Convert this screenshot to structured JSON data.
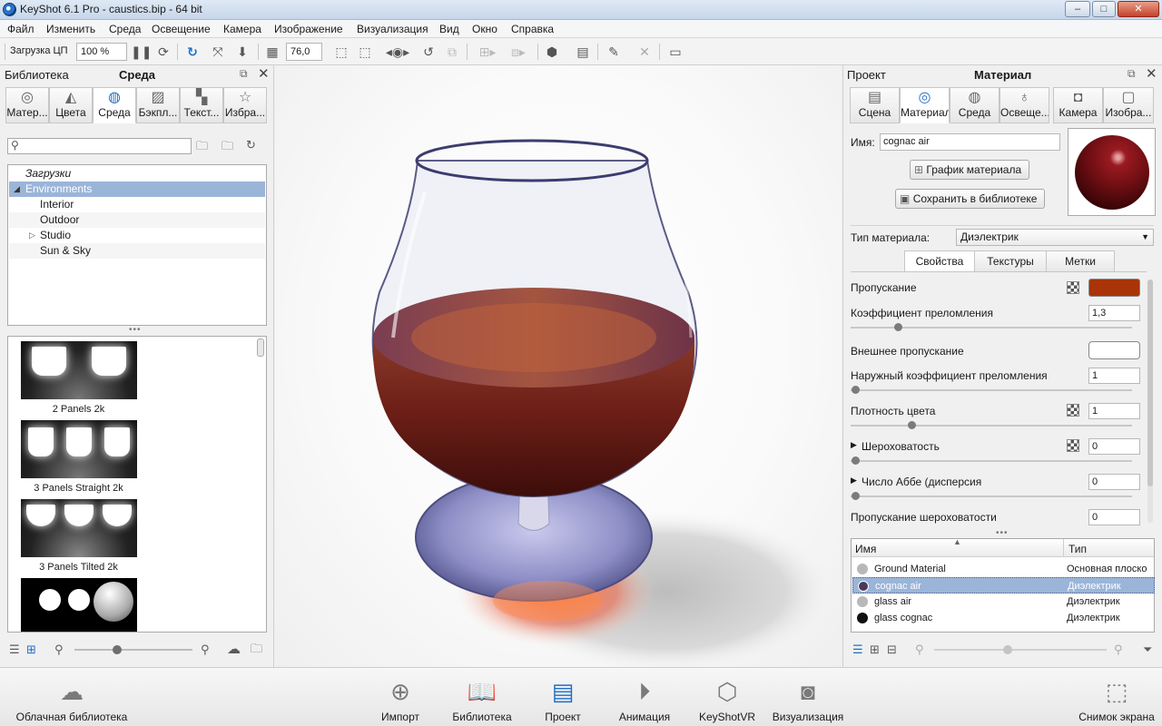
{
  "titlebar": {
    "title": "KeyShot 6.1 Pro  - caustics.bip  - 64 bit",
    "minimize": "–",
    "maximize": "□",
    "close": "✕"
  },
  "menu": [
    "Файл",
    "Изменить",
    "Среда",
    "Освещение",
    "Камера",
    "Изображение",
    "Визуализация",
    "Вид",
    "Окно",
    "Справка"
  ],
  "toolbar": {
    "cpu_label": "Загрузка ЦП",
    "zoom_value": "100 %",
    "fov_value": "76,0"
  },
  "left": {
    "title_left": "Библиотека",
    "title_center": "Среда",
    "tabs": [
      "Матер...",
      "Цвета",
      "Среда",
      "Бэкпл...",
      "Текст...",
      "Избра..."
    ],
    "search_placeholder": "",
    "tree": [
      {
        "label": "Загрузки"
      },
      {
        "label": "Environments"
      },
      {
        "label": "Interior"
      },
      {
        "label": "Outdoor"
      },
      {
        "label": "Studio"
      },
      {
        "label": "Sun & Sky"
      }
    ],
    "thumbs": [
      {
        "label": "2 Panels 2k"
      },
      {
        "label": "3 Panels Straight 2k"
      },
      {
        "label": "3 Panels Tilted 2k"
      }
    ]
  },
  "right": {
    "title_left": "Проект",
    "title_center": "Материал",
    "tabs": [
      "Сцена",
      "Материал",
      "Среда",
      "Освеще...",
      "Камера",
      "Изобра..."
    ],
    "name_label": "Имя:",
    "name_value": "cognac air",
    "graph_button": "График материала",
    "save_button": "Сохранить в библиотеке",
    "material_type_label": "Тип материала:",
    "material_type_value": "Диэлектрик",
    "subtabs": [
      "Свойства",
      "Текстуры",
      "Метки"
    ],
    "props": [
      {
        "label": "Пропускание"
      },
      {
        "label": "Коэффициент преломления",
        "value": "1,3"
      },
      {
        "label": "Внешнее пропускание"
      },
      {
        "label": "Наружный коэффициент преломления",
        "value": "1"
      },
      {
        "label": "Плотность цвета",
        "value": "1"
      },
      {
        "label": "Шероховатость",
        "value": "0"
      },
      {
        "label": "Число Аббе (дисперсия",
        "value": "0"
      },
      {
        "label": "Пропускание шероховатости",
        "value": "0"
      }
    ],
    "transmission_color": "#a83408",
    "table_headers": [
      "Имя",
      "Тип"
    ],
    "table_rows": [
      {
        "name": "Ground Material",
        "type": "Основная плоско",
        "color": "#b8b8b8"
      },
      {
        "name": "cognac air",
        "type": "Диэлектрик",
        "color": "#4a3a5a"
      },
      {
        "name": "glass air",
        "type": "Диэлектрик",
        "color": "#b8b8b8"
      },
      {
        "name": "glass cognac",
        "type": "Диэлектрик",
        "color": "#111111"
      }
    ]
  },
  "bottom": [
    "Облачная библиотека",
    "Импорт",
    "Библиотека",
    "Проект",
    "Анимация",
    "KeyShotVR",
    "Визуализация",
    "Снимок экрана"
  ]
}
